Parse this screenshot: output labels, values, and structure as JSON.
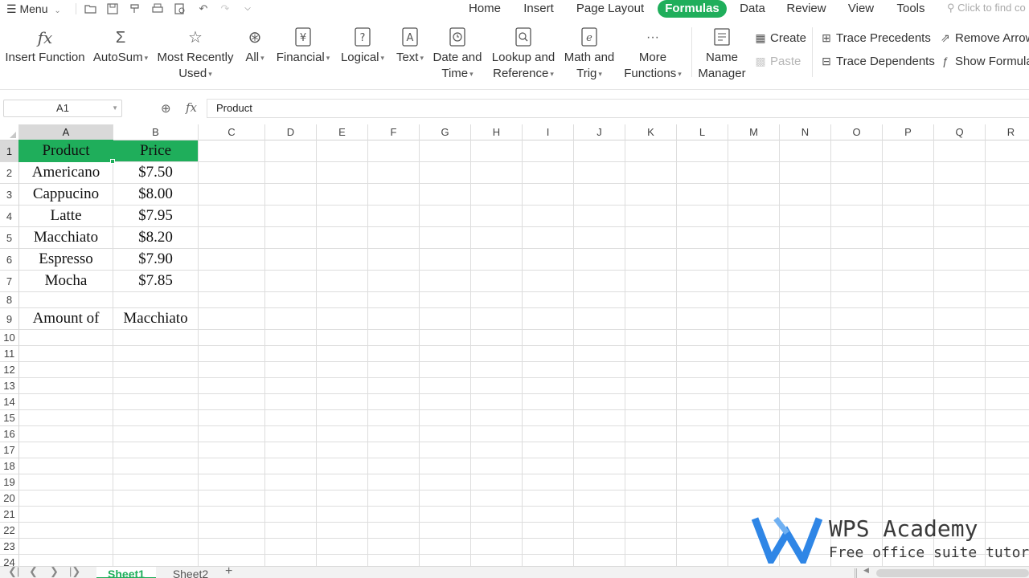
{
  "topbar": {
    "menu_label": "Menu",
    "quick_access_icons": [
      "open-folder-icon",
      "save-icon",
      "format-painter-icon",
      "print-icon",
      "print-preview-icon",
      "undo-icon",
      "redo-icon",
      "customize-quick-access-icon"
    ],
    "tabs": [
      {
        "label": "Home",
        "active": false
      },
      {
        "label": "Insert",
        "active": false
      },
      {
        "label": "Page Layout",
        "active": false
      },
      {
        "label": "Formulas",
        "active": true
      },
      {
        "label": "Data",
        "active": false
      },
      {
        "label": "Review",
        "active": false
      },
      {
        "label": "View",
        "active": false
      },
      {
        "label": "Tools",
        "active": false
      }
    ],
    "search_placeholder": "Click to find co"
  },
  "ribbon": {
    "insert_function": "Insert Function",
    "autosum": "AutoSum",
    "most_recently_line1": "Most Recently",
    "most_recently_line2": "Used",
    "all": "All",
    "financial": "Financial",
    "logical": "Logical",
    "text": "Text",
    "date_time_line1": "Date and",
    "date_time_line2": "Time",
    "lookup_line1": "Lookup and",
    "lookup_line2": "Reference",
    "math_line1": "Math and",
    "math_line2": "Trig",
    "more_line1": "More",
    "more_line2": "Functions",
    "name_manager_line1": "Name",
    "name_manager_line2": "Manager",
    "create": "Create",
    "paste": "Paste",
    "trace_precedents": "Trace Precedents",
    "trace_dependents": "Trace Dependents",
    "remove_arrows": "Remove Arrow",
    "show_formulas": "Show Formula"
  },
  "formula_bar": {
    "name_box": "A1",
    "content": "Product"
  },
  "sheet": {
    "columns": [
      "A",
      "B",
      "C",
      "D",
      "E",
      "F",
      "G",
      "H",
      "I",
      "J",
      "K",
      "L",
      "M",
      "N",
      "O",
      "P",
      "Q",
      "R"
    ],
    "rows": [
      "1",
      "2",
      "3",
      "4",
      "5",
      "6",
      "7",
      "8",
      "9",
      "10",
      "11",
      "12",
      "13",
      "14",
      "15",
      "16",
      "17",
      "18",
      "19",
      "20",
      "21",
      "22",
      "23",
      "24"
    ],
    "selected_cell": "A1",
    "header_fill": "#1fae5b",
    "cells": {
      "A1": "Product",
      "B1": "Price",
      "A2": "Americano",
      "B2": "$7.50",
      "A3": "Cappucino",
      "B3": "$8.00",
      "A4": "Latte",
      "B4": "$7.95",
      "A5": "Macchiato",
      "B5": "$8.20",
      "A6": "Espresso",
      "B6": "$7.90",
      "A7": "Mocha",
      "B7": "$7.85",
      "A9": "Amount of",
      "B9": "Macchiato"
    }
  },
  "sheet_tabs": [
    {
      "label": "Sheet1",
      "active": true
    },
    {
      "label": "Sheet2",
      "active": false
    }
  ],
  "watermark": {
    "title": "WPS Academy",
    "subtitle": "Free office suite tutorials",
    "brand_color": "#2f86e6"
  },
  "colors": {
    "accent": "#1fae5b"
  }
}
